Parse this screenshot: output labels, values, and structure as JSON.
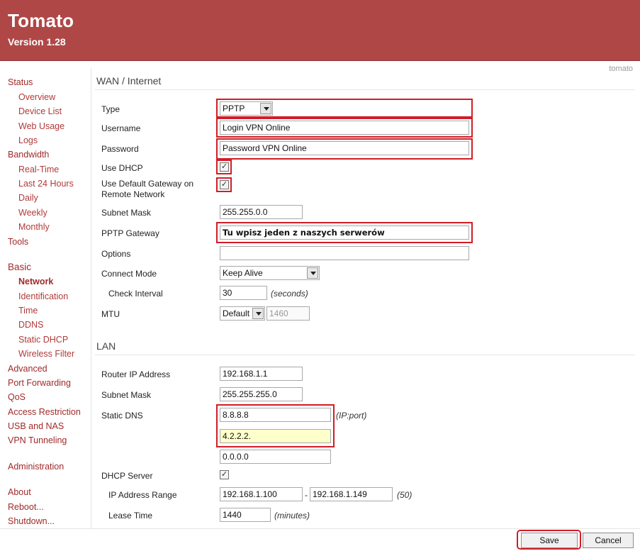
{
  "header": {
    "title": "Tomato",
    "version": "Version 1.28"
  },
  "corner_label": "tomato",
  "sidebar": {
    "status": "Status",
    "overview": "Overview",
    "device_list": "Device List",
    "web_usage": "Web Usage",
    "logs": "Logs",
    "bandwidth": "Bandwidth",
    "real_time": "Real-Time",
    "last_24_hours": "Last 24 Hours",
    "daily": "Daily",
    "weekly": "Weekly",
    "monthly": "Monthly",
    "tools": "Tools",
    "basic": "Basic",
    "network": "Network",
    "identification": "Identification",
    "time": "Time",
    "ddns": "DDNS",
    "static_dhcp": "Static DHCP",
    "wireless_filter": "Wireless Filter",
    "advanced": "Advanced",
    "port_forwarding": "Port Forwarding",
    "qos": "QoS",
    "access_restriction": "Access Restriction",
    "usb_and_nas": "USB and NAS",
    "vpn_tunneling": "VPN Tunneling",
    "administration": "Administration",
    "about": "About",
    "reboot": "Reboot...",
    "shutdown": "Shutdown..."
  },
  "wan": {
    "title": "WAN / Internet",
    "type_label": "Type",
    "type_value": "PPTP",
    "username_label": "Username",
    "username_value": "Login VPN Online",
    "password_label": "Password",
    "password_value": "Password VPN Online",
    "use_dhcp_label": "Use DHCP",
    "use_default_gateway_label": "Use Default Gateway on Remote Network",
    "subnet_mask_label": "Subnet Mask",
    "subnet_mask_value": "255.255.0.0",
    "pptp_gateway_label": "PPTP Gateway",
    "pptp_gateway_value": "Tu wpisz jeden z naszych serwerów",
    "options_label": "Options",
    "options_value": "",
    "connect_mode_label": "Connect Mode",
    "connect_mode_value": "Keep Alive",
    "check_interval_label": "Check Interval",
    "check_interval_value": "30",
    "check_interval_hint": "(seconds)",
    "mtu_label": "MTU",
    "mtu_mode_value": "Default",
    "mtu_value": "1460"
  },
  "lan": {
    "title": "LAN",
    "router_ip_label": "Router IP Address",
    "router_ip_value": "192.168.1.1",
    "subnet_mask_label": "Subnet Mask",
    "subnet_mask_value": "255.255.255.0",
    "static_dns_label": "Static DNS",
    "dns1_value": "8.8.8.8",
    "dns2_value": "4.2.2.2.",
    "dns3_value": "0.0.0.0",
    "dns_hint": "(IP:port)",
    "dhcp_server_label": "DHCP Server",
    "ip_range_label": "IP Address Range",
    "ip_range_start": "192.168.1.100",
    "ip_range_sep": "-",
    "ip_range_end": "192.168.1.149",
    "ip_range_count": "(50)",
    "lease_time_label": "Lease Time",
    "lease_time_value": "1440",
    "lease_time_hint": "(minutes)"
  },
  "buttons": {
    "save": "Save",
    "cancel": "Cancel"
  },
  "colors": {
    "header_bg": "#b04747",
    "nav_link": "#a02a2a",
    "highlight": "#d11d26",
    "dns_field": "#ffffcc"
  }
}
